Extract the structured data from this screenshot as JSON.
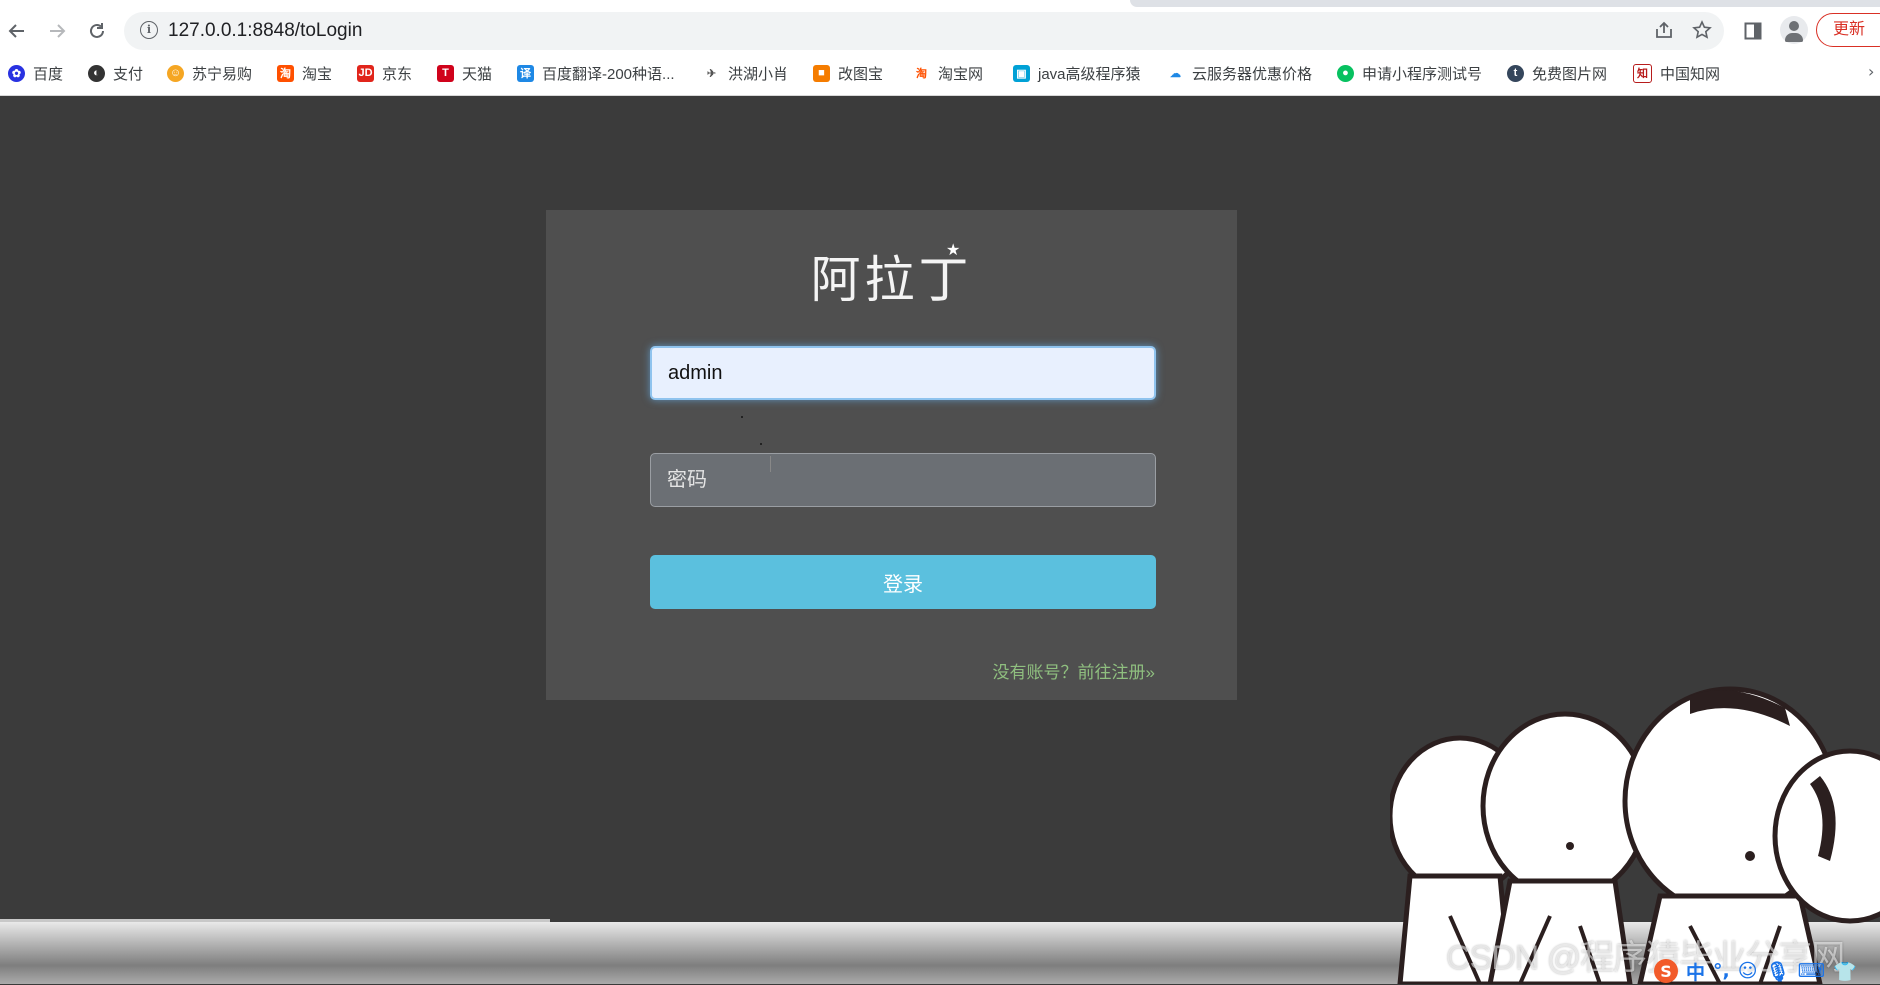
{
  "browser": {
    "url": "127.0.0.1:8848/toLogin",
    "update_label": "更新",
    "bookmarks": [
      {
        "label": "百度",
        "icon": "baidu-icon",
        "color": "#2932e1"
      },
      {
        "label": "支付",
        "icon": "pay-icon",
        "color": "#333333"
      },
      {
        "label": "苏宁易购",
        "icon": "suning-icon",
        "color": "#f5a623"
      },
      {
        "label": "淘宝",
        "icon": "taobao-icon",
        "color": "#ff5000"
      },
      {
        "label": "京东",
        "icon": "jd-icon",
        "color": "#e1251b"
      },
      {
        "label": "天猫",
        "icon": "tmall-icon",
        "color": "#d0021b"
      },
      {
        "label": "百度翻译-200种语...",
        "icon": "translate-icon",
        "color": "#1e88e5"
      },
      {
        "label": "洪湖小肖",
        "icon": "rocket-icon",
        "color": "#555555"
      },
      {
        "label": "改图宝",
        "icon": "gaitubao-icon",
        "color": "#f57c00"
      },
      {
        "label": "淘宝网",
        "icon": "taobao-icon",
        "color": "#ff5000"
      },
      {
        "label": "java高级程序猿",
        "icon": "bilibili-icon",
        "color": "#00a1d6"
      },
      {
        "label": "云服务器优惠价格",
        "icon": "cloud-icon",
        "color": "#1e88e5"
      },
      {
        "label": "申请小程序测试号",
        "icon": "wechat-icon",
        "color": "#07c160"
      },
      {
        "label": "免费图片网",
        "icon": "t-icon",
        "color": "#35465c"
      },
      {
        "label": "中国知网",
        "icon": "cnki-icon",
        "color": "#b71c1c"
      }
    ]
  },
  "login": {
    "logo_text": "阿拉丁",
    "username_value": "admin",
    "password_placeholder": "密码",
    "submit_label": "登录",
    "register_link": "没有账号？前往注册»"
  },
  "overlay": {
    "watermark": "CSDN @程序猿毕业分享网",
    "ime_label": "中"
  },
  "colors": {
    "page_bg": "#3b3b3b",
    "panel_bg": "#4f4f4f",
    "button": "#5bc0de",
    "link": "#8fbf7f",
    "update": "#d93025"
  }
}
